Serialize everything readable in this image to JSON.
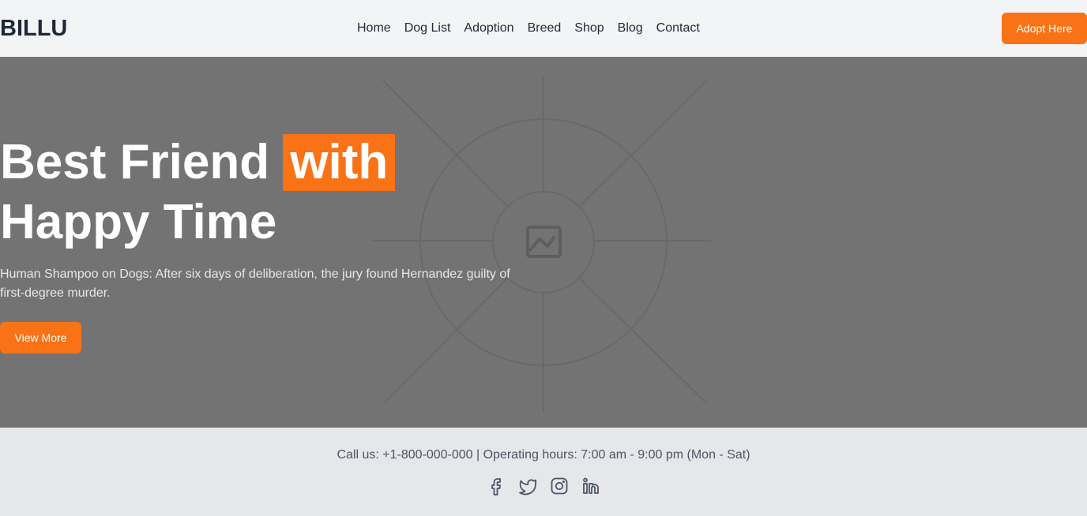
{
  "brand": {
    "logo": "BILLU",
    "accent": "#f97316"
  },
  "nav": {
    "links": [
      "Home",
      "Dog List",
      "Adoption",
      "Breed",
      "Shop",
      "Blog",
      "Contact"
    ],
    "cta": "Adopt Here"
  },
  "hero": {
    "title_part1": "Best Friend",
    "title_highlight": "with",
    "title_part2": "Happy Time",
    "description": "Human Shampoo on Dogs: After six days of deliberation, the jury found Hernandez guilty of first-degree murder.",
    "button": "View More",
    "background_icon": "image-placeholder-icon"
  },
  "footer": {
    "contact": "Call us: +1-800-000-000 | Operating hours: 7:00 am - 9:00 pm (Mon - Sat)",
    "socials": [
      "facebook-icon",
      "twitter-icon",
      "instagram-icon",
      "linkedin-icon"
    ]
  }
}
